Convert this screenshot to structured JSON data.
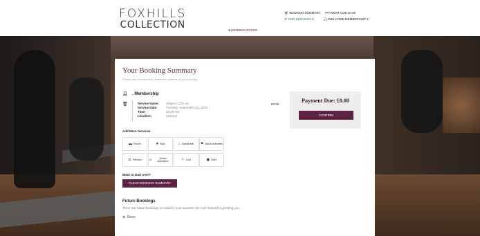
{
  "brand": {
    "line1": "FOXHILLS",
    "line2": "COLLECTION"
  },
  "header": {
    "booking_summary": "BOOKING SUMMARY",
    "payment_due": "PAYMENT DUE £0.00",
    "our_services": "OUR SERVICES",
    "welcome": "WELCOME MEMBERSHIP",
    "member_notice": "MEMBER NOTICE"
  },
  "summary": {
    "title": "Your Booking Summary",
    "subtitle": "Please take a moment to review the contents of your booking.",
    "member_name": ". Membership",
    "service": {
      "labels": {
        "name": "Service Name:",
        "date": "Service Date:",
        "time": "Time:",
        "location": "Location:"
      },
      "name": "Stages Cycle 45",
      "date": "Tuesday, September 03, 2024",
      "time": "07:00 AM",
      "location": "Classes"
    },
    "price": "£0.00"
  },
  "payment": {
    "due_label": "Payment Due: £0.00",
    "confirm_label": "CONFIRM"
  },
  "add_services": {
    "label": "Add More Services",
    "tiles": [
      {
        "label": "Room",
        "icon": "bed-icon"
      },
      {
        "label": "Spa",
        "icon": "leaf-icon"
      },
      {
        "label": "Banquets",
        "icon": "bell-icon"
      },
      {
        "label": "Adult Activities",
        "icon": "activities-icon"
      },
      {
        "label": "Fitness",
        "icon": "fitness-icon"
      },
      {
        "label": "Junior Activities",
        "icon": "child-icon"
      },
      {
        "label": "Golf",
        "icon": "flag-icon"
      },
      {
        "label": "Dine",
        "icon": "dine-icon"
      }
    ]
  },
  "start_over": {
    "label": "Want to start over?",
    "button": "CLEAR BOOKING SUMMARY"
  },
  "future": {
    "title": "Future Bookings",
    "text": "There are future Bookings recorded in your account. We look forward to greeting you.",
    "show": "Show"
  },
  "colors": {
    "accent": "#5e2344",
    "title": "#5e2b4a",
    "green": "#2a6e4e"
  }
}
